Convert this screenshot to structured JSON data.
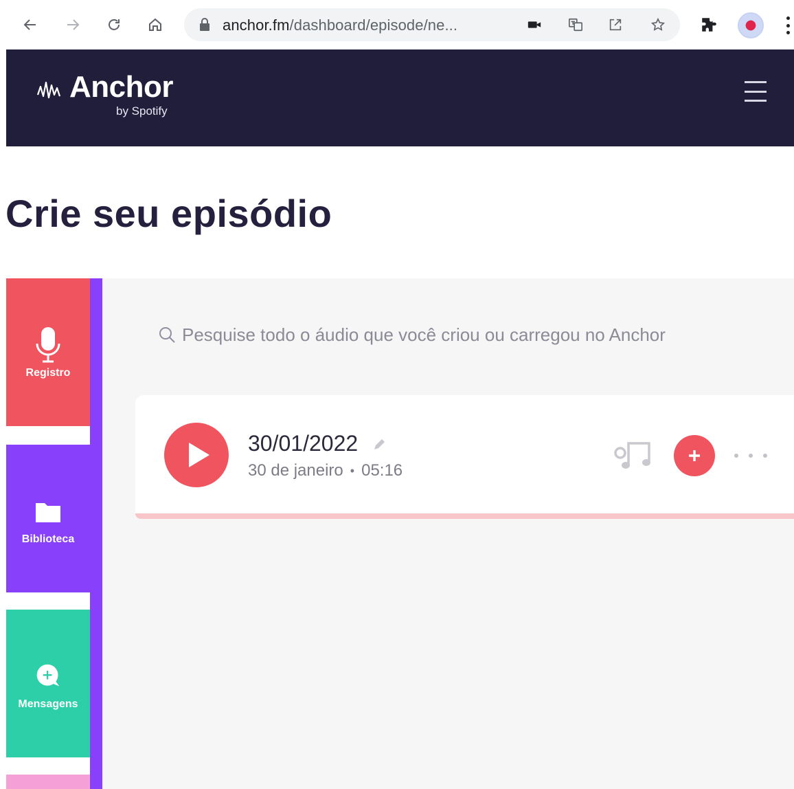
{
  "browser": {
    "url_host": "anchor.fm",
    "url_path": "/dashboard/episode/ne...",
    "icons": [
      "back-icon",
      "forward-icon",
      "reload-icon",
      "home-icon",
      "lock-icon",
      "camera-icon",
      "translate-icon",
      "share-icon",
      "star-icon",
      "extensions-icon",
      "profile-avatar",
      "menu-icon"
    ]
  },
  "header": {
    "logo_text": "Anchor",
    "logo_sub": "by Spotify",
    "menu_icon": "hamburger-icon"
  },
  "page": {
    "title": "Crie seu episódio"
  },
  "tools": [
    {
      "label": "Registro",
      "icon": "microphone-icon",
      "color": "#f0545e"
    },
    {
      "label": "Biblioteca",
      "icon": "folder-icon",
      "color": "#8940fa"
    },
    {
      "label": "Mensagens",
      "icon": "message-plus-icon",
      "color": "#2ccfa8"
    }
  ],
  "search": {
    "placeholder": "Pesquise todo o áudio que você criou ou carregou no Anchor",
    "value": ""
  },
  "episode": {
    "title": "30/01/2022",
    "date": "30 de janeiro",
    "separator": "•",
    "duration": "05:16",
    "icons": [
      "play-icon",
      "edit-pencil-icon",
      "music-icon",
      "add-icon",
      "more-icon"
    ]
  },
  "colors": {
    "header_bg": "#211e3b",
    "accent_red": "#f0545e",
    "accent_purple": "#8940fa",
    "accent_teal": "#2ccfa8"
  }
}
